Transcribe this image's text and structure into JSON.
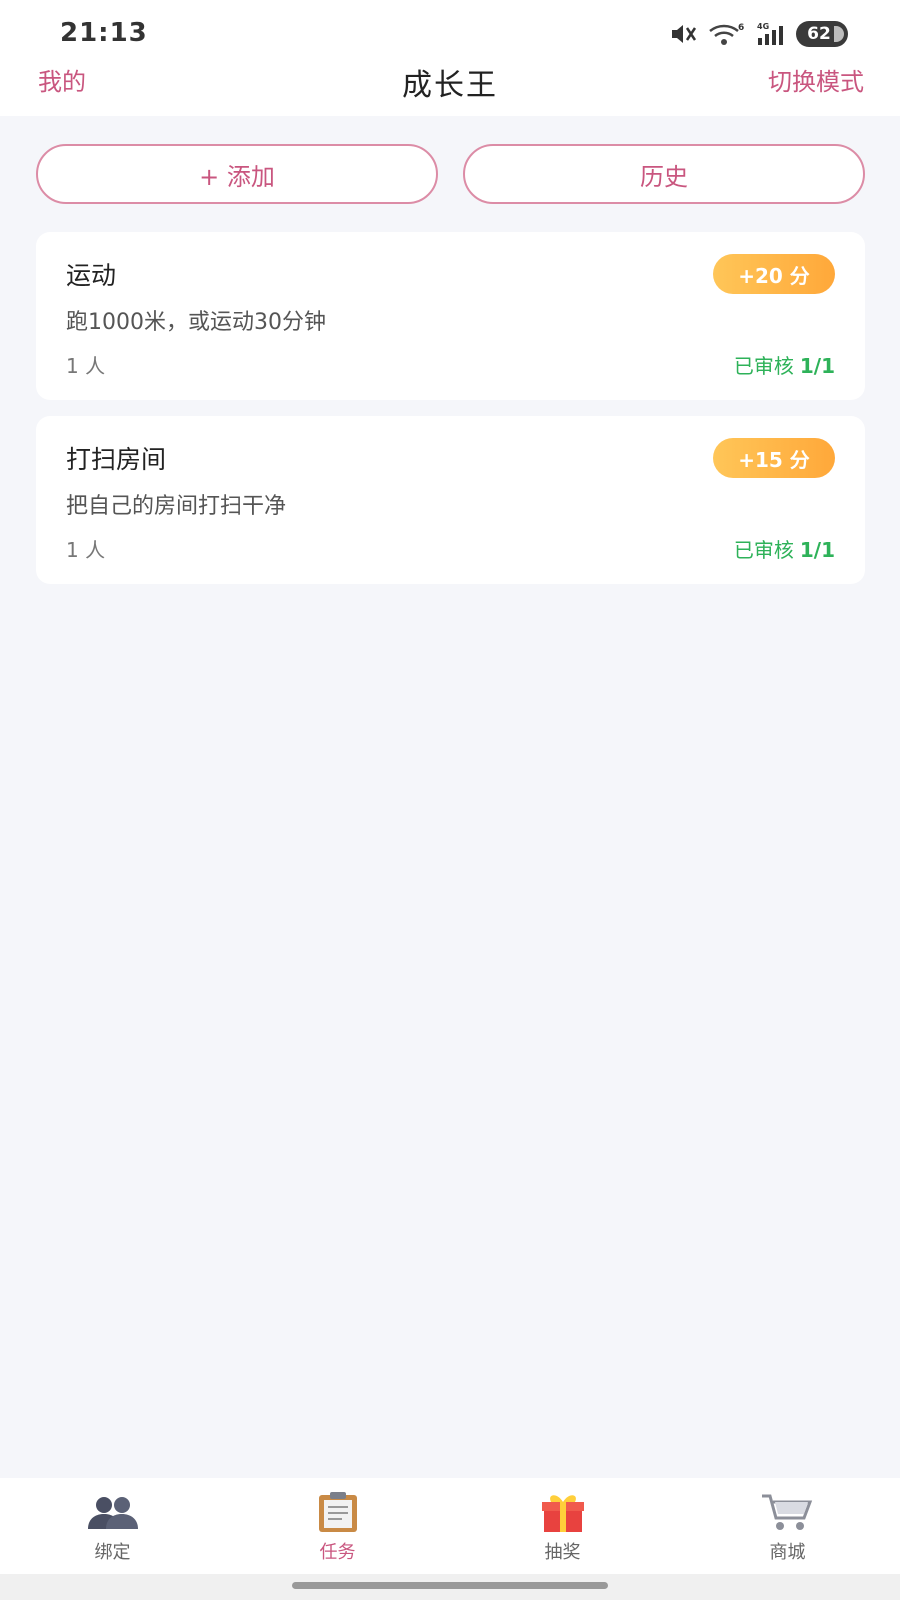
{
  "status_bar": {
    "time": "21:13",
    "network_label": "4G",
    "wifi_label": "6",
    "battery": "62"
  },
  "header": {
    "left": "我的",
    "title": "成长王",
    "right": "切换模式"
  },
  "actions": {
    "add": "+ 添加",
    "history": "历史"
  },
  "tasks": [
    {
      "title": "运动",
      "points": "+20 分",
      "description": "跑1000米，或运动30分钟",
      "people": "1 人",
      "status_label": "已审核",
      "status_count": "1/1"
    },
    {
      "title": "打扫房间",
      "points": "+15 分",
      "description": "把自己的房间打扫干净",
      "people": "1 人",
      "status_label": "已审核",
      "status_count": "1/1"
    }
  ],
  "tabbar": {
    "items": [
      {
        "label": "绑定",
        "icon": "users-icon",
        "active": false
      },
      {
        "label": "任务",
        "icon": "clipboard-icon",
        "active": true
      },
      {
        "label": "抽奖",
        "icon": "gift-icon",
        "active": false
      },
      {
        "label": "商城",
        "icon": "cart-icon",
        "active": false
      }
    ]
  },
  "colors": {
    "accent": "#c9567f",
    "approved": "#2eb259",
    "points_badge": "#ffb347"
  }
}
